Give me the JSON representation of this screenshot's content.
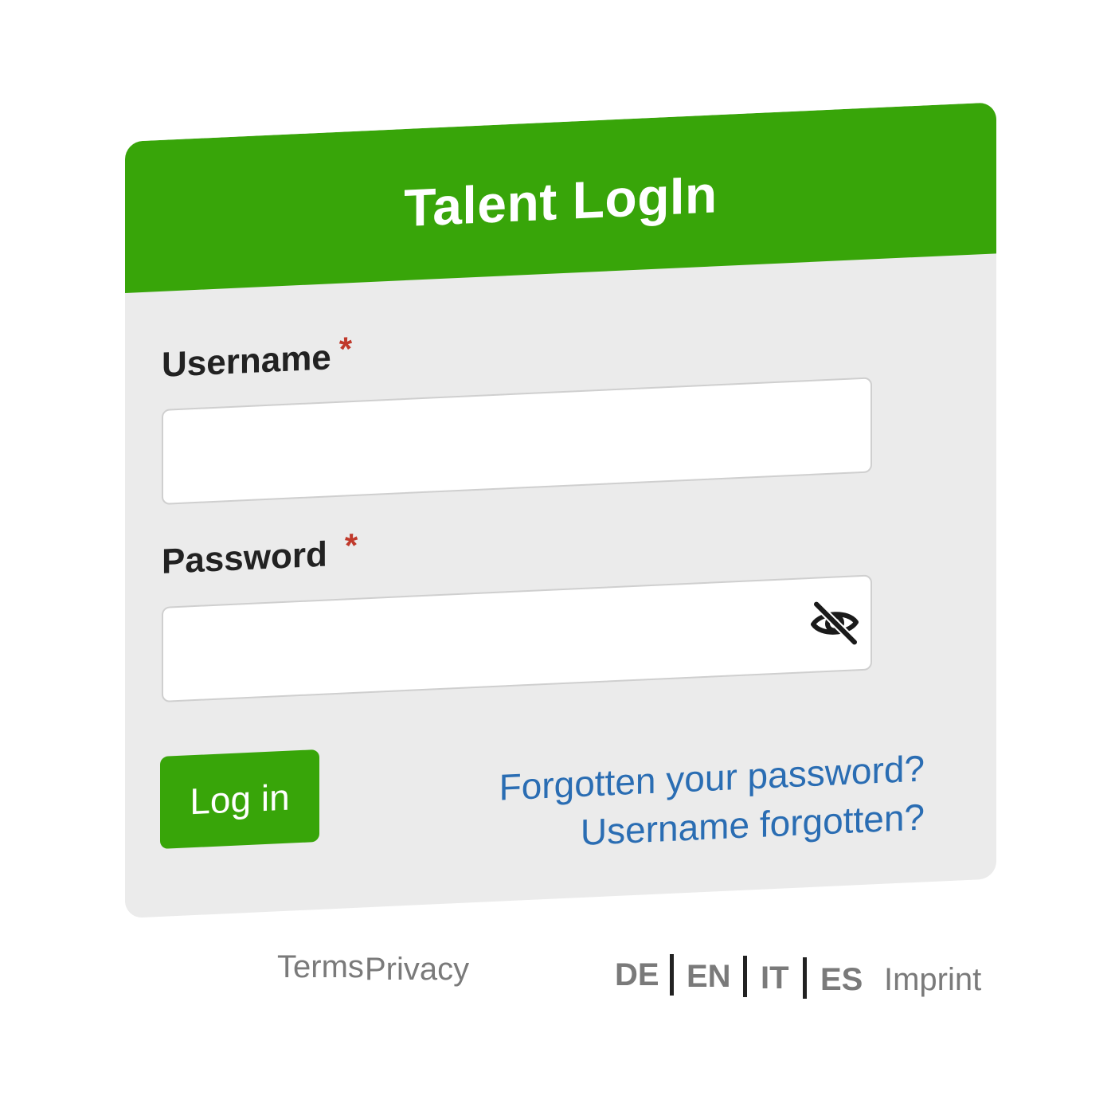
{
  "header": {
    "title": "Talent LogIn"
  },
  "form": {
    "username_label": "Username",
    "password_label": "Password",
    "required_marker": "*",
    "username_value": "",
    "password_value": "",
    "login_button": "Log in",
    "forgot_password": "Forgotten your password?",
    "forgot_username": "Username forgotten?"
  },
  "footer": {
    "terms": "Terms",
    "privacy": "Privacy",
    "languages": [
      "DE",
      "EN",
      "IT",
      "ES"
    ],
    "imprint": "Imprint"
  },
  "icons": {
    "password_toggle": "eye-slash-icon"
  },
  "colors": {
    "brand_green": "#38a509",
    "link_blue": "#2a6db3",
    "required_red": "#c0392b",
    "card_bg": "#ebebeb",
    "footer_text": "#7a7a7a"
  }
}
